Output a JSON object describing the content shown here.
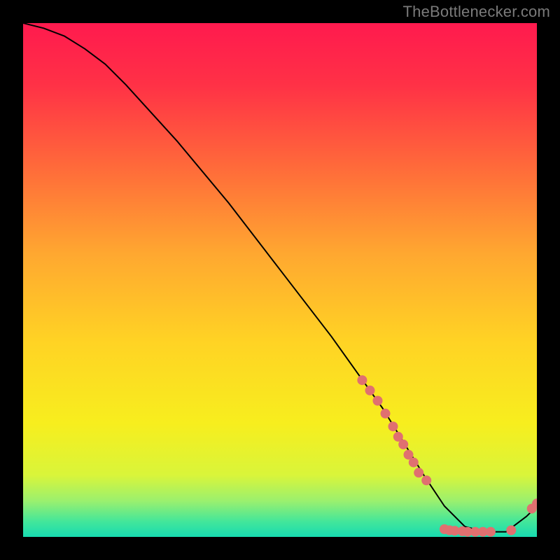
{
  "watermark": "TheBottlenecker.com",
  "chart_data": {
    "type": "line",
    "title": "",
    "xlabel": "",
    "ylabel": "",
    "xlim": [
      0,
      100
    ],
    "ylim": [
      0,
      100
    ],
    "series": [
      {
        "name": "curve",
        "x": [
          0,
          4,
          8,
          12,
          16,
          20,
          30,
          40,
          50,
          60,
          70,
          78,
          82,
          86,
          90,
          94,
          98,
          100
        ],
        "values": [
          100,
          99,
          97.5,
          95,
          92,
          88,
          77,
          65,
          52,
          39,
          25,
          12,
          6,
          2,
          1,
          1,
          4,
          6
        ]
      }
    ],
    "markers": {
      "name": "scatter-points",
      "color": "#e07070",
      "points": [
        {
          "x": 66,
          "y": 30.5
        },
        {
          "x": 67.5,
          "y": 28.5
        },
        {
          "x": 69,
          "y": 26.5
        },
        {
          "x": 70.5,
          "y": 24
        },
        {
          "x": 72,
          "y": 21.5
        },
        {
          "x": 73,
          "y": 19.5
        },
        {
          "x": 74,
          "y": 18
        },
        {
          "x": 75,
          "y": 16
        },
        {
          "x": 76,
          "y": 14.5
        },
        {
          "x": 77,
          "y": 12.5
        },
        {
          "x": 78.5,
          "y": 11
        },
        {
          "x": 82,
          "y": 1.5
        },
        {
          "x": 83,
          "y": 1.3
        },
        {
          "x": 84,
          "y": 1.2
        },
        {
          "x": 85.5,
          "y": 1.1
        },
        {
          "x": 86.5,
          "y": 1.0
        },
        {
          "x": 88,
          "y": 1.0
        },
        {
          "x": 89.5,
          "y": 1.0
        },
        {
          "x": 91,
          "y": 1.0
        },
        {
          "x": 95,
          "y": 1.3
        },
        {
          "x": 99,
          "y": 5.5
        },
        {
          "x": 100,
          "y": 6.5
        }
      ]
    },
    "background": {
      "type": "vertical-gradient",
      "stops": [
        {
          "pos": 0.0,
          "color": "#ff1a4e"
        },
        {
          "pos": 0.12,
          "color": "#ff3146"
        },
        {
          "pos": 0.28,
          "color": "#ff6a3a"
        },
        {
          "pos": 0.45,
          "color": "#ffa830"
        },
        {
          "pos": 0.62,
          "color": "#ffd324"
        },
        {
          "pos": 0.78,
          "color": "#f7ee1e"
        },
        {
          "pos": 0.88,
          "color": "#d9f53a"
        },
        {
          "pos": 0.93,
          "color": "#9bf06e"
        },
        {
          "pos": 0.97,
          "color": "#43e69a"
        },
        {
          "pos": 1.0,
          "color": "#17dbb0"
        }
      ]
    }
  }
}
